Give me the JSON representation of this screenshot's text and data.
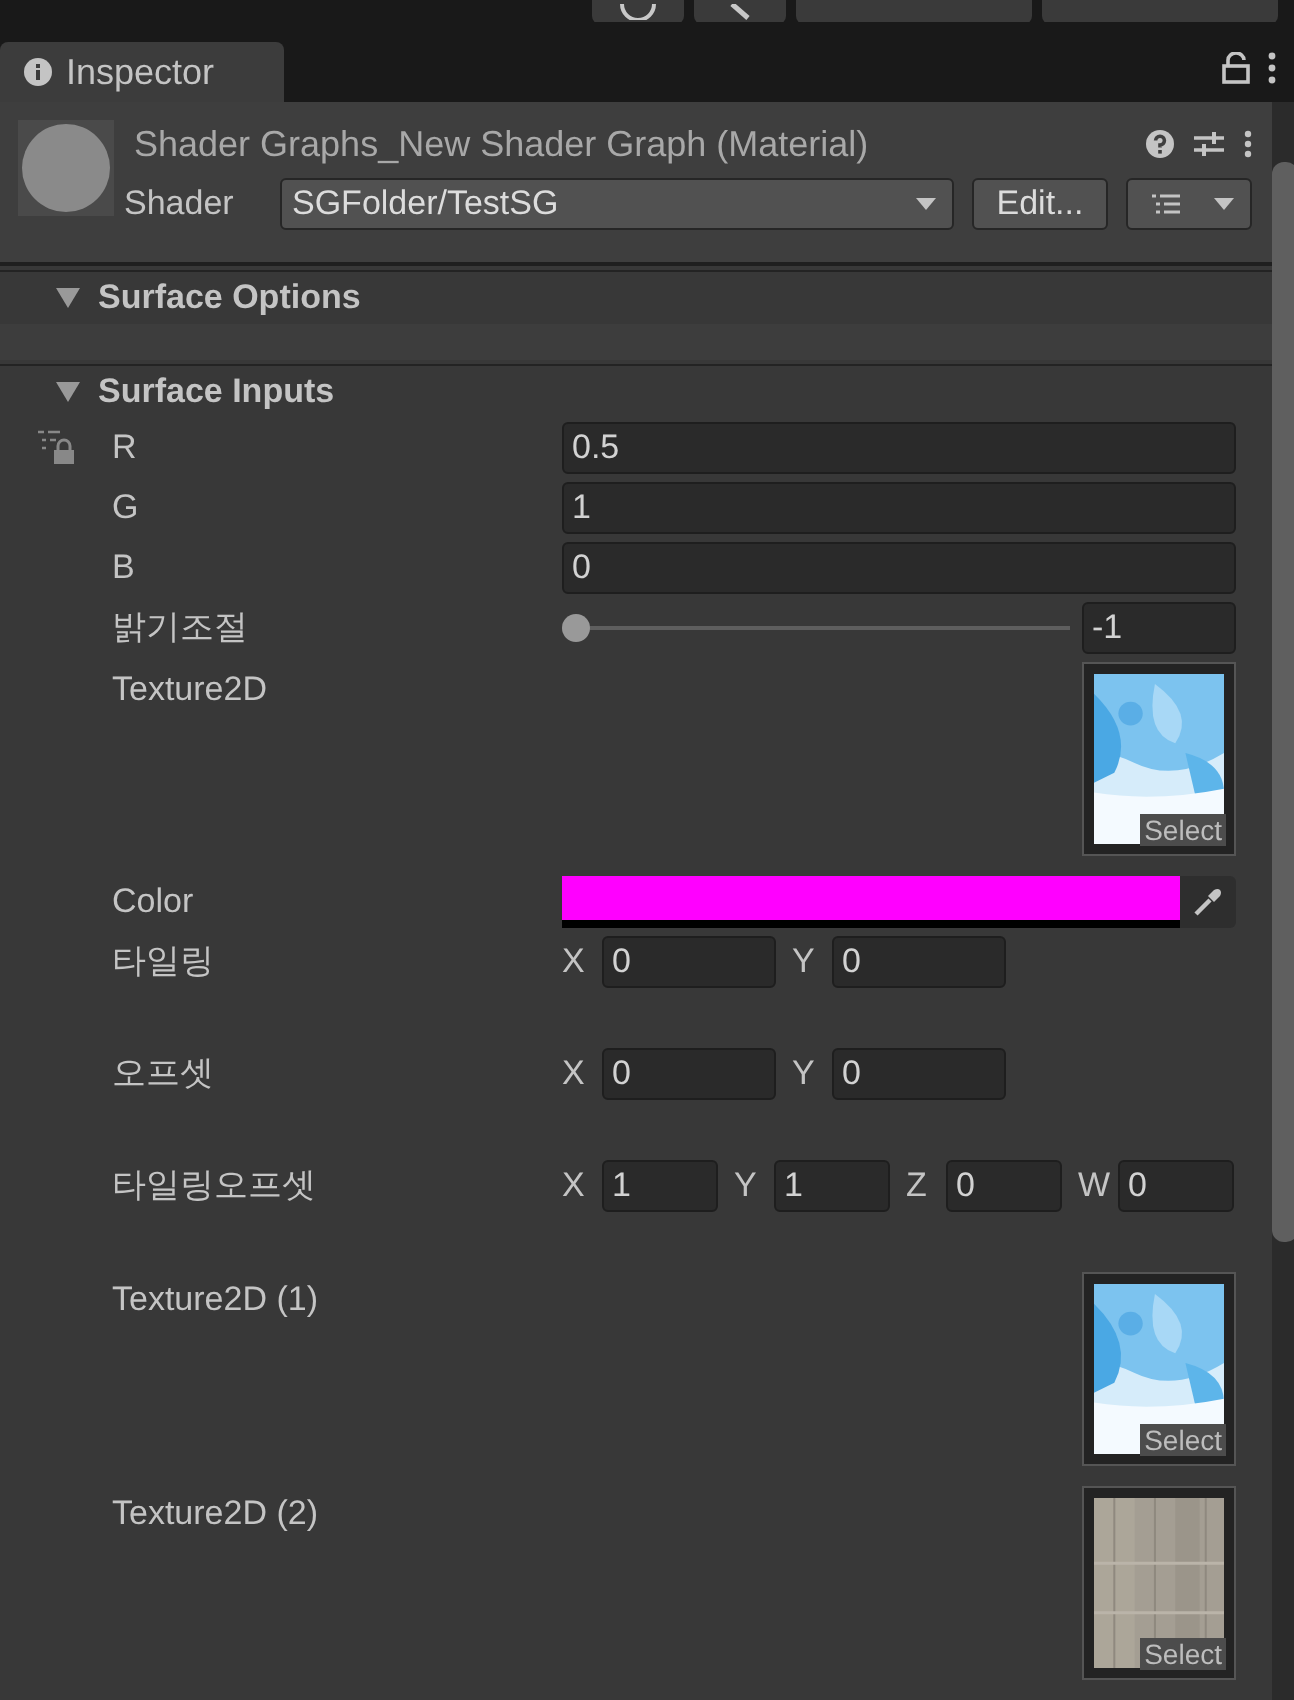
{
  "tab": {
    "label": "Inspector",
    "selected": true
  },
  "material": {
    "title": "Shader Graphs_New Shader Graph (Material)",
    "shader_label": "Shader",
    "shader": "SGFolder/TestSG",
    "edit_button": "Edit..."
  },
  "sections": [
    {
      "title": "Surface Options",
      "expanded": true
    },
    {
      "title": "Surface Inputs",
      "expanded": true,
      "properties": [
        {
          "kind": "float",
          "label": "R",
          "value": "0.5"
        },
        {
          "kind": "float",
          "label": "G",
          "value": "1"
        },
        {
          "kind": "float",
          "label": "B",
          "value": "0"
        },
        {
          "kind": "slider",
          "label": "밝기조절",
          "level": 0,
          "value": "-1"
        },
        {
          "kind": "texture",
          "label": "Texture2D",
          "select": "Select"
        },
        {
          "kind": "color",
          "label": "Color",
          "color": "#ff00ff"
        },
        {
          "kind": "vector",
          "label": "타일링",
          "components": [
            {
              "axis": "X",
              "value": "0"
            },
            {
              "axis": "Y",
              "value": "0"
            }
          ]
        },
        {
          "kind": "vector",
          "label": "오프셋",
          "components": [
            {
              "axis": "X",
              "value": "0"
            },
            {
              "axis": "Y",
              "value": "0"
            }
          ]
        },
        {
          "kind": "vector",
          "label": "타일링오프셋",
          "components": [
            {
              "axis": "X",
              "value": "1"
            },
            {
              "axis": "Y",
              "value": "1"
            },
            {
              "axis": "Z",
              "value": "0"
            },
            {
              "axis": "W",
              "value": "0"
            }
          ]
        },
        {
          "kind": "texture",
          "label": "Texture2D (1)",
          "select": "Select"
        },
        {
          "kind": "texture",
          "label": "Texture2D (2)",
          "select": "Select"
        }
      ]
    }
  ]
}
